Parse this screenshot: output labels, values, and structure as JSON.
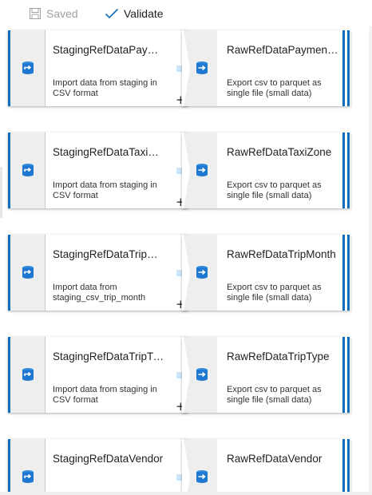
{
  "toolbar": {
    "saved_label": "Saved",
    "validate_label": "Validate",
    "accent_color": "#0f6cbd"
  },
  "activities": [
    {
      "source": {
        "title": "StagingRefDataPayment...",
        "description": "Import data from staging in CSV format",
        "icon": "copy-data-icon"
      },
      "target": {
        "title": "RawRefDataPaymentType",
        "description": "Export csv to parquet as single file (small data)",
        "icon": "dataflow-icon"
      }
    },
    {
      "source": {
        "title": "StagingRefDataTaxiZone",
        "description": "Import data from staging in CSV format",
        "icon": "copy-data-icon"
      },
      "target": {
        "title": "RawRefDataTaxiZone",
        "description": "Export csv to parquet as single file (small data)",
        "icon": "dataflow-icon"
      }
    },
    {
      "source": {
        "title": "StagingRefDataTripMonth",
        "description": "Import data from staging_csv_trip_month",
        "icon": "copy-data-icon"
      },
      "target": {
        "title": "RawRefDataTripMonth",
        "description": "Export csv to parquet as single file (small data)",
        "icon": "dataflow-icon"
      }
    },
    {
      "source": {
        "title": "StagingRefDataTripType",
        "description": "Import data from staging in CSV format",
        "icon": "copy-data-icon"
      },
      "target": {
        "title": "RawRefDataTripType",
        "description": "Export csv to parquet as single file (small data)",
        "icon": "dataflow-icon"
      }
    },
    {
      "source": {
        "title": "StagingRefDataVendor",
        "description": "",
        "icon": "copy-data-icon"
      },
      "target": {
        "title": "RawRefDataVendor",
        "description": "",
        "icon": "dataflow-icon"
      }
    }
  ],
  "plus_symbol": "+"
}
